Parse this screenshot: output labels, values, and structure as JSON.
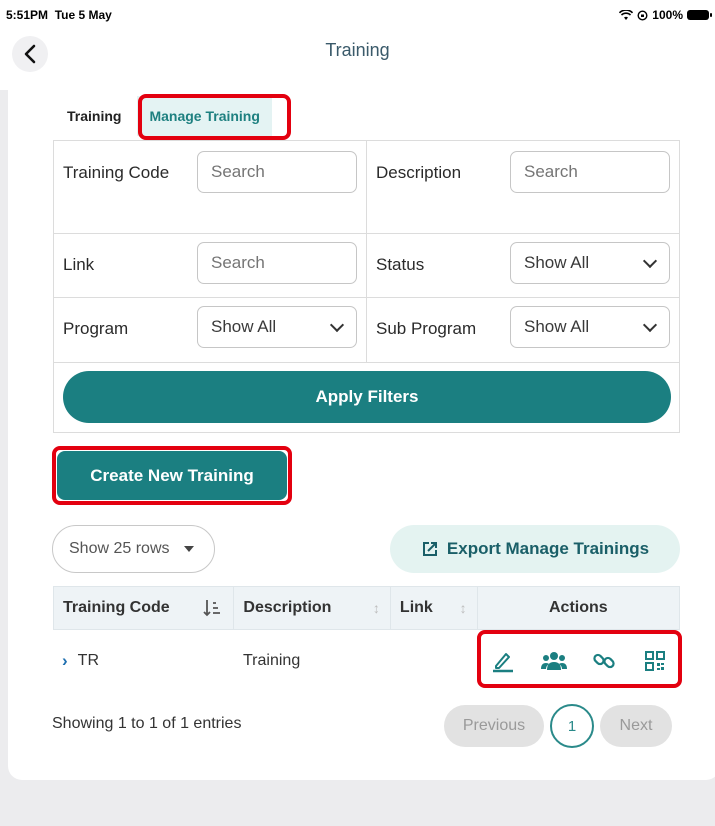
{
  "status_bar": {
    "time": "5:51PM",
    "date": "Tue 5 May",
    "battery": "100%"
  },
  "nav": {
    "title": "Training"
  },
  "tabs": [
    {
      "label": "Training"
    },
    {
      "label": "Manage Training"
    }
  ],
  "filters": {
    "training_code_label": "Training Code",
    "training_code_placeholder": "Search",
    "description_label": "Description",
    "description_placeholder": "Search",
    "link_label": "Link",
    "link_placeholder": "Search",
    "status_label": "Status",
    "status_value": "Show All",
    "program_label": "Program",
    "program_value": "Show All",
    "sub_program_label": "Sub Program",
    "sub_program_value": "Show All",
    "apply_label": "Apply Filters"
  },
  "create_label": "Create New Training",
  "rows_select": "Show 25 rows",
  "export_label": "Export Manage Trainings",
  "table": {
    "headers": [
      "Training Code",
      "Description",
      "Link",
      "Actions"
    ],
    "rows": [
      {
        "code": "TR",
        "description": "Training",
        "link": ""
      }
    ]
  },
  "pagination": {
    "info": "Showing 1 to 1 of 1 entries",
    "previous": "Previous",
    "page": "1",
    "next": "Next"
  },
  "colors": {
    "accent": "#1b7f81",
    "highlight": "#e3000f"
  }
}
